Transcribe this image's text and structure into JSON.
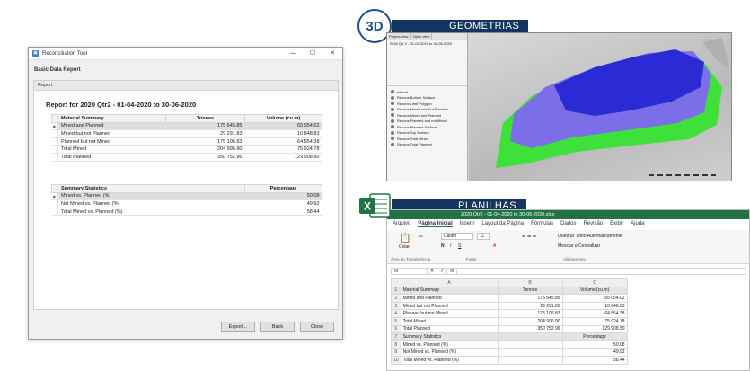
{
  "dialog": {
    "window_title": "Reconciliation Tool",
    "controls": [
      "—",
      "☐",
      "✕"
    ],
    "subtitle": "Basic Data Report",
    "panel_label": "Report",
    "report_title": "Report for 2020 Qtr2 - 01-04-2020 to 30-06-2020",
    "material": {
      "headers": [
        "Material Summary",
        "Tonnes",
        "Volume (cu.m)"
      ],
      "rows": [
        [
          "Mined and Planned",
          "175 645.85",
          "65 054.02"
        ],
        [
          "Mined but not Planned",
          "29 291.83",
          "10 848.83"
        ],
        [
          "Planned but not Mined",
          "175 106.83",
          "64 854.38"
        ],
        [
          "Total Mined",
          "204 996.90",
          "75 924.78"
        ],
        [
          "Total Planned",
          "350 752.96",
          "129 908.50"
        ]
      ]
    },
    "stats": {
      "headers": [
        "Summary Statistics",
        "Percentage"
      ],
      "rows": [
        [
          "Mined vs. Planned (%)",
          "50.08"
        ],
        [
          "Not Mined vs. Planned (%)",
          "49.92"
        ],
        [
          "Total Mined vs. Planned (%)",
          "58.44"
        ]
      ]
    },
    "buttons": {
      "export": "Export...",
      "back": "Back",
      "close": "Close"
    }
  },
  "geometrias": {
    "badge": "3D",
    "banner": "GEOMETRIAS",
    "tabs": [
      "Project view",
      "Open view"
    ],
    "tree_item": "2020 Qtr 2 - 01-04-2020 to 30-06-2020",
    "layers": [
      "default",
      "Recons Bottom Surface",
      "Recons Limit Polygon",
      "Recons Mined and Not Planned",
      "Recons Mined and Planned",
      "Recons Planned and not Mined",
      "Recons Planned Surface",
      "Recons Top Surface",
      "Recons Total Mined",
      "Recons Total Planned"
    ],
    "colors": {
      "blue": "#2b2bd6",
      "purple": "#7b6ee6",
      "green": "#3ee03a"
    }
  },
  "planilhas": {
    "banner": "PLANILHAS",
    "file_title": "2020 Qtr2 - 01-04-2020 to 30-06-2020.xlsx",
    "tabs": [
      "Arquivo",
      "Página Inicial",
      "Inserir",
      "Layout da Página",
      "Fórmulas",
      "Dados",
      "Revisão",
      "Exibir",
      "Ajuda"
    ],
    "ribbon": {
      "paste": "Colar",
      "font_name": "Calibri",
      "font_size": "11",
      "wrap": "Quebrar Texto Automaticamente",
      "merge": "Mesclar e Centralizar",
      "clipboard": "Área de Transferência",
      "font": "Fonte",
      "alignment": "Alinhamento"
    },
    "cell_ref": "I9",
    "fx": "fx",
    "col_headers": [
      "A",
      "B",
      "C"
    ],
    "rows": [
      [
        "1",
        "Material Summary",
        "Tonnes",
        "Volume (cu.m)"
      ],
      [
        "2",
        "Mined and Planned",
        "175 645.85",
        "65 054.02"
      ],
      [
        "3",
        "Mined but not Planned",
        "29 291.83",
        "10 848.83"
      ],
      [
        "4",
        "Planned but not Mined",
        "175 106.83",
        "64 854.38"
      ],
      [
        "5",
        "Total Mined",
        "204 996.90",
        "75 924.78"
      ],
      [
        "6",
        "Total Planned",
        "350 752.96",
        "129 908.50"
      ],
      [
        "7",
        "Summary Statistics",
        "",
        "Percentage"
      ],
      [
        "8",
        "Mined vs. Planned (%)",
        "",
        "50.08"
      ],
      [
        "9",
        "Not Mined vs. Planned (%)",
        "",
        "49.92"
      ],
      [
        "10",
        "Total Mined vs. Planned (%)",
        "",
        "58.44"
      ]
    ],
    "brand_color": "#217346"
  }
}
